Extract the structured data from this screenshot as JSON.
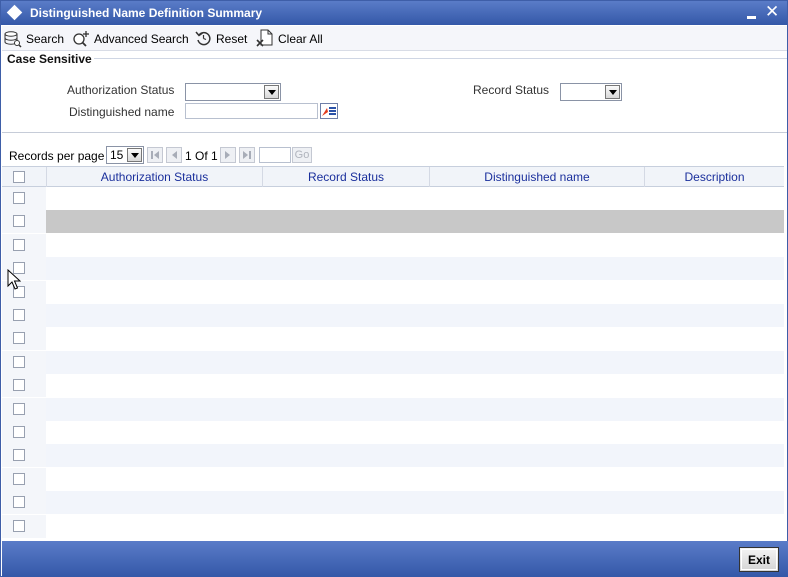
{
  "window": {
    "title": "Distinguished Name Definition Summary"
  },
  "toolbar": {
    "search": "Search",
    "advanced_search": "Advanced Search",
    "reset": "Reset",
    "clear_all": "Clear All"
  },
  "criteria": {
    "section_label": "Case Sensitive",
    "authorization_status_label": "Authorization Status",
    "authorization_status_value": "",
    "record_status_label": "Record Status",
    "record_status_value": "",
    "distinguished_name_label": "Distinguished name",
    "distinguished_name_value": ""
  },
  "pager": {
    "records_per_page_label": "Records per page",
    "records_per_page_value": "15",
    "page_info": "1 Of 1",
    "jump_value": "",
    "go_label": "Go"
  },
  "grid": {
    "columns": [
      "Authorization Status",
      "Record Status",
      "Distinguished name",
      "Description"
    ],
    "row_count": 15,
    "selected_row": 1
  },
  "footer": {
    "exit_label": "Exit"
  },
  "colors": {
    "titlebar": "#3e5ea8",
    "header_text": "#1a2f9c",
    "selected_row": "#c8c8c8",
    "alt_row": "#f2f5fb"
  },
  "icons": {
    "title": "diamond-icon",
    "search": "database-search-icon",
    "advanced_search": "advanced-search-icon",
    "reset": "reset-icon",
    "clear_all": "clear-all-icon",
    "lov": "list-of-values-icon"
  }
}
